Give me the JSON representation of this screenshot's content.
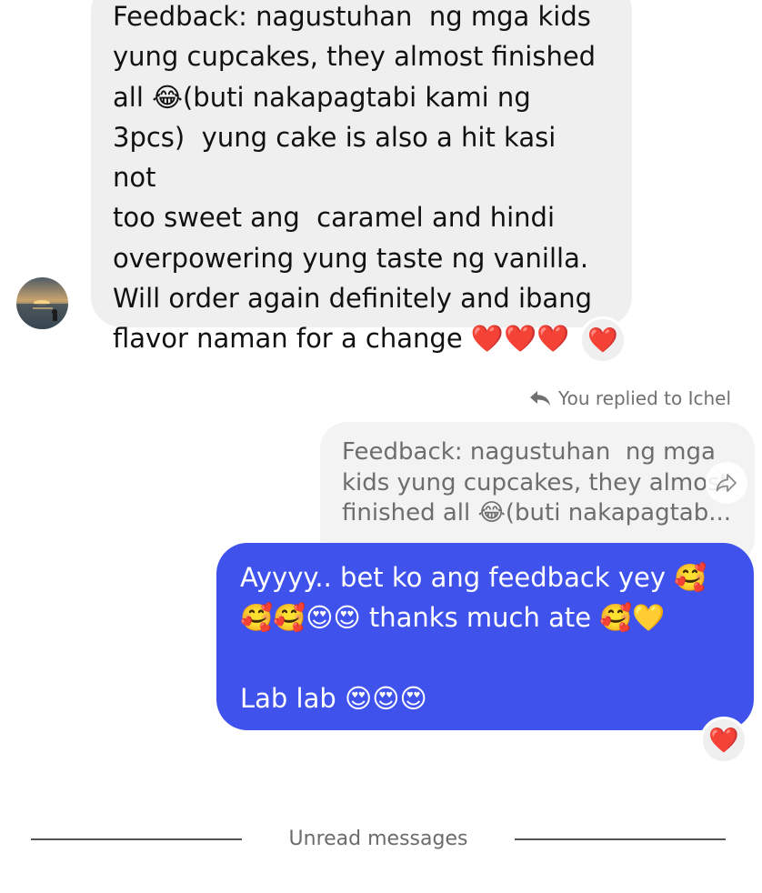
{
  "incoming_message": {
    "text": "Feedback: nagustuhan  ng mga kids\nyung cupcakes, they almost finished\nall 😂(buti nakapagtabi kami ng\n3pcs)  yung cake is also a hit kasi not\ntoo sweet ang  caramel and hindi\noverpowering yung taste ng vanilla.\nWill order again definitely and ibang\nflavor naman for a change ❤️❤️❤️",
    "reaction": "❤️"
  },
  "reply_header": {
    "icon": "reply-arrow-icon",
    "text": "You replied to Ichel"
  },
  "quoted_message": {
    "text": "Feedback: nagustuhan  ng mga\nkids yung cupcakes, they almost\nfinished all 😂(buti nakapagtab..."
  },
  "outgoing_message": {
    "text": "Ayyyy.. bet ko ang feedback yey 🥰\n🥰🥰😍😍 thanks much ate 🥰💛\n\nLab lab 😍😍😍",
    "reaction": "❤️"
  },
  "divider": {
    "label": "Unread messages"
  },
  "colors": {
    "incoming_bubble": "#efefef",
    "outgoing_bubble": "#3f53ec",
    "reaction_heart": "#e0202a",
    "meta_text": "#707070"
  }
}
